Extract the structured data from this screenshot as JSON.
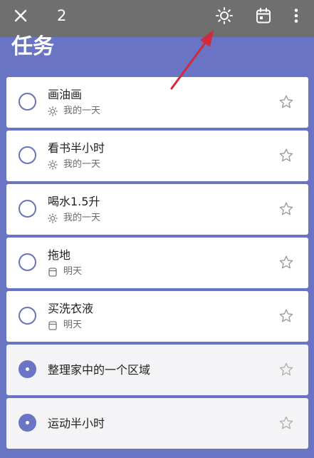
{
  "toolbar": {
    "selected_count": "2",
    "icons": [
      "close-icon",
      "sun-icon",
      "calendar-icon",
      "more-vertical-icon"
    ]
  },
  "page": {
    "title": "任务"
  },
  "tasks": [
    {
      "title": "画油画",
      "sub": "我的一天",
      "sub_icon": "sun-icon",
      "selected": false
    },
    {
      "title": "看书半小时",
      "sub": "我的一天",
      "sub_icon": "sun-icon",
      "selected": false
    },
    {
      "title": "喝水1.5升",
      "sub": "我的一天",
      "sub_icon": "sun-icon",
      "selected": false
    },
    {
      "title": "拖地",
      "sub": "明天",
      "sub_icon": "calendar-icon",
      "selected": false
    },
    {
      "title": "买洗衣液",
      "sub": "明天",
      "sub_icon": "calendar-icon",
      "selected": false
    },
    {
      "title": "整理家中的一个区域",
      "sub": "",
      "sub_icon": "",
      "selected": true
    },
    {
      "title": "运动半小时",
      "sub": "",
      "sub_icon": "",
      "selected": true
    }
  ],
  "colors": {
    "accent": "#6974c4",
    "toolbar": "#6f6f6f",
    "arrow": "#d22a3c"
  }
}
